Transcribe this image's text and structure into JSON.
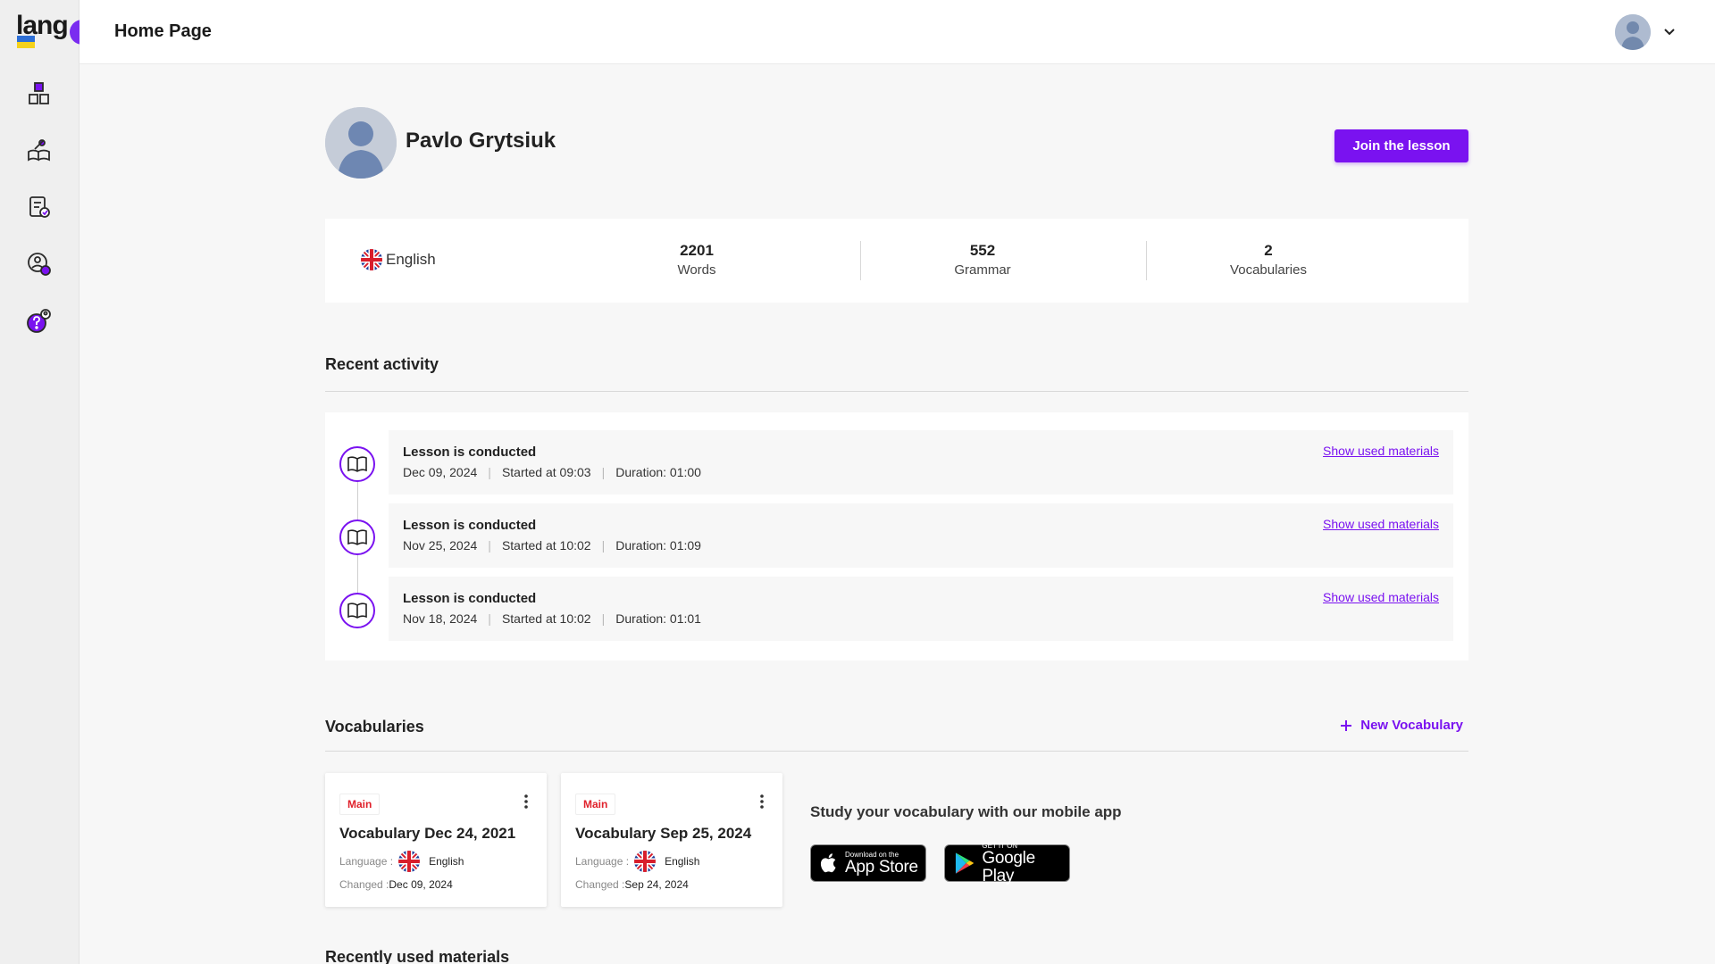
{
  "app": {
    "logo_text": "lang"
  },
  "header": {
    "title": "Home Page"
  },
  "sidebar": {
    "items": [
      {
        "icon": "blocks-icon"
      },
      {
        "icon": "books-icon"
      },
      {
        "icon": "test-icon"
      },
      {
        "icon": "students-icon"
      },
      {
        "icon": "help-icon"
      }
    ]
  },
  "profile": {
    "name": "Pavlo Grytsiuk",
    "join_label": "Join the lesson"
  },
  "stats": {
    "language": "English",
    "items": [
      {
        "value": "2201",
        "label": "Words"
      },
      {
        "value": "552",
        "label": "Grammar"
      },
      {
        "value": "2",
        "label": "Vocabularies"
      }
    ]
  },
  "activity": {
    "title": "Recent activity",
    "items": [
      {
        "title": "Lesson is conducted",
        "date": "Dec 09, 2024",
        "started": "Started at 09:03",
        "duration": "Duration: 01:00",
        "link": "Show used materials"
      },
      {
        "title": "Lesson is conducted",
        "date": "Nov 25, 2024",
        "started": "Started at 10:02",
        "duration": "Duration: 01:09",
        "link": "Show used materials"
      },
      {
        "title": "Lesson is conducted",
        "date": "Nov 18, 2024",
        "started": "Started at 10:02",
        "duration": "Duration: 01:01",
        "link": "Show used materials"
      }
    ]
  },
  "vocabularies": {
    "title": "Vocabularies",
    "new_label": "New Vocabulary",
    "language_label": "Language :",
    "changed_label": "Changed :",
    "items": [
      {
        "badge": "Main",
        "title": "Vocabulary Dec 24, 2021",
        "language": "English",
        "changed": "Dec 09, 2024"
      },
      {
        "badge": "Main",
        "title": "Vocabulary Sep 25, 2024",
        "language": "English",
        "changed": "Sep 24, 2024"
      }
    ],
    "promo": "Study your vocabulary with our mobile app",
    "appstore_small": "Download on the",
    "appstore_big": "App Store",
    "googleplay_small": "GET IT ON",
    "googleplay_big": "Google Play"
  },
  "recent_materials": {
    "title": "Recently used materials"
  },
  "colors": {
    "accent": "#7a12f0",
    "badge": "#e0212b"
  }
}
